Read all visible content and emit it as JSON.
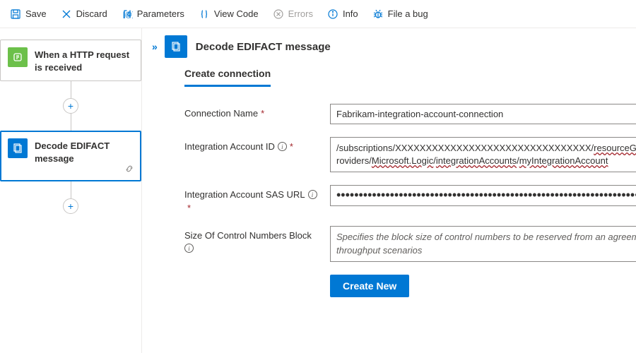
{
  "toolbar": {
    "save": "Save",
    "discard": "Discard",
    "parameters": "Parameters",
    "view_code": "View Code",
    "errors": "Errors",
    "info": "Info",
    "file_bug": "File a bug"
  },
  "canvas": {
    "trigger_title": "When a HTTP request is received",
    "action_title": "Decode EDIFACT message"
  },
  "panel": {
    "title": "Decode EDIFACT message",
    "section": "Create connection",
    "fields": {
      "conn_name": {
        "label": "Connection Name",
        "value": "Fabrikam-integration-account-connection"
      },
      "acct_id": {
        "label": "Integration Account ID",
        "value": "/subscriptions/XXXXXXXXXXXXXXXXXXXXXXXXXXXXXXXX/resourceGroups/integrationAccount-RG/providers/Microsoft.Logic/integrationAccounts/myIntegrationAccount"
      },
      "sas_url": {
        "label": "Integration Account SAS URL",
        "value": "••••••••••••••••••••••••••••••••••••••••••••••••••••••••••••••••••••••••••••••••••••••••••••••••"
      },
      "block_size": {
        "label": "Size Of Control Numbers Block",
        "placeholder": "Specifies the block size of control numbers to be reserved from an agreement. This is intended for high throughput scenarios"
      }
    },
    "create_btn": "Create New"
  }
}
